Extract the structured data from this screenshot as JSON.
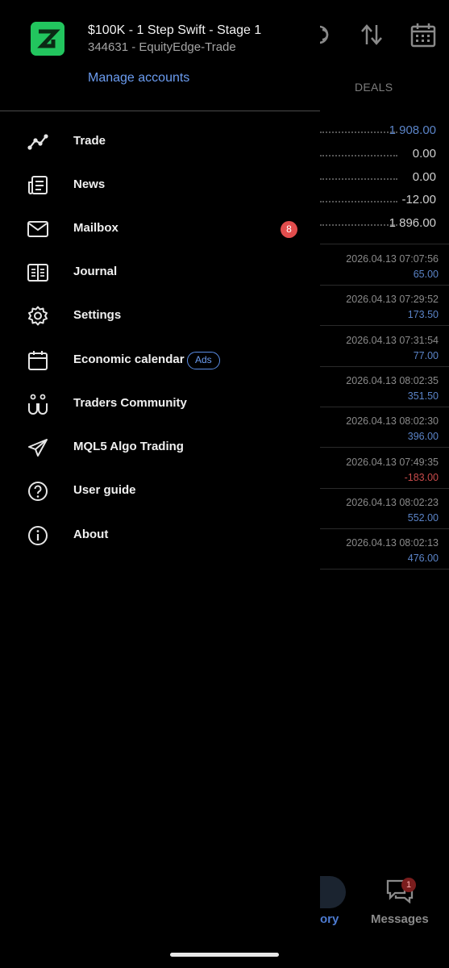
{
  "background": {
    "tab_deals": "DEALS",
    "summary_values": [
      "1 908.00",
      "0.00",
      "0.00",
      "-12.00",
      "1 896.00"
    ],
    "deals": [
      {
        "time": "2026.04.13 07:07:56",
        "amount": "65.00",
        "negative": false
      },
      {
        "time": "2026.04.13 07:29:52",
        "amount": "173.50",
        "negative": false
      },
      {
        "time": "2026.04.13 07:31:54",
        "amount": "77.00",
        "negative": false
      },
      {
        "time": "2026.04.13 08:02:35",
        "amount": "351.50",
        "negative": false
      },
      {
        "time": "2026.04.13 08:02:30",
        "amount": "396.00",
        "negative": false
      },
      {
        "time": "2026.04.13 07:49:35",
        "amount": "-183.00",
        "negative": true
      },
      {
        "time": "2026.04.13 08:02:23",
        "amount": "552.00",
        "negative": false
      },
      {
        "time": "2026.04.13 08:02:13",
        "amount": "476.00",
        "negative": false
      }
    ],
    "bottom_nav": {
      "partial_label": "ory",
      "messages_label": "Messages",
      "messages_badge": "1"
    },
    "top_icons": [
      "coins-icon",
      "sort-arrows-icon",
      "calendar-icon"
    ]
  },
  "drawer": {
    "account": {
      "name": "$100K - 1 Step Swift - Stage 1",
      "id_server": "344631 - EquityEdge-Trade",
      "manage_label": "Manage accounts",
      "logo_icon": "equityedge-logo-icon"
    },
    "menu": [
      {
        "label": "Trade",
        "icon": "trade-chart-icon"
      },
      {
        "label": "News",
        "icon": "news-icon"
      },
      {
        "label": "Mailbox",
        "icon": "mail-icon",
        "badge": "8"
      },
      {
        "label": "Journal",
        "icon": "journal-icon"
      },
      {
        "label": "Settings",
        "icon": "gear-icon"
      },
      {
        "label": "Economic calendar",
        "icon": "calendar-icon",
        "pill": "Ads"
      },
      {
        "label": "Traders Community",
        "icon": "community-icon"
      },
      {
        "label": "MQL5 Algo Trading",
        "icon": "send-icon"
      },
      {
        "label": "User guide",
        "icon": "help-icon"
      },
      {
        "label": "About",
        "icon": "info-icon"
      }
    ]
  },
  "colors": {
    "accent_blue": "#6b9cf0",
    "badge_red": "#e24d4d",
    "logo_green": "#22c55e",
    "profit_blue": "#5b84c8",
    "loss_red": "#c94b4b"
  }
}
